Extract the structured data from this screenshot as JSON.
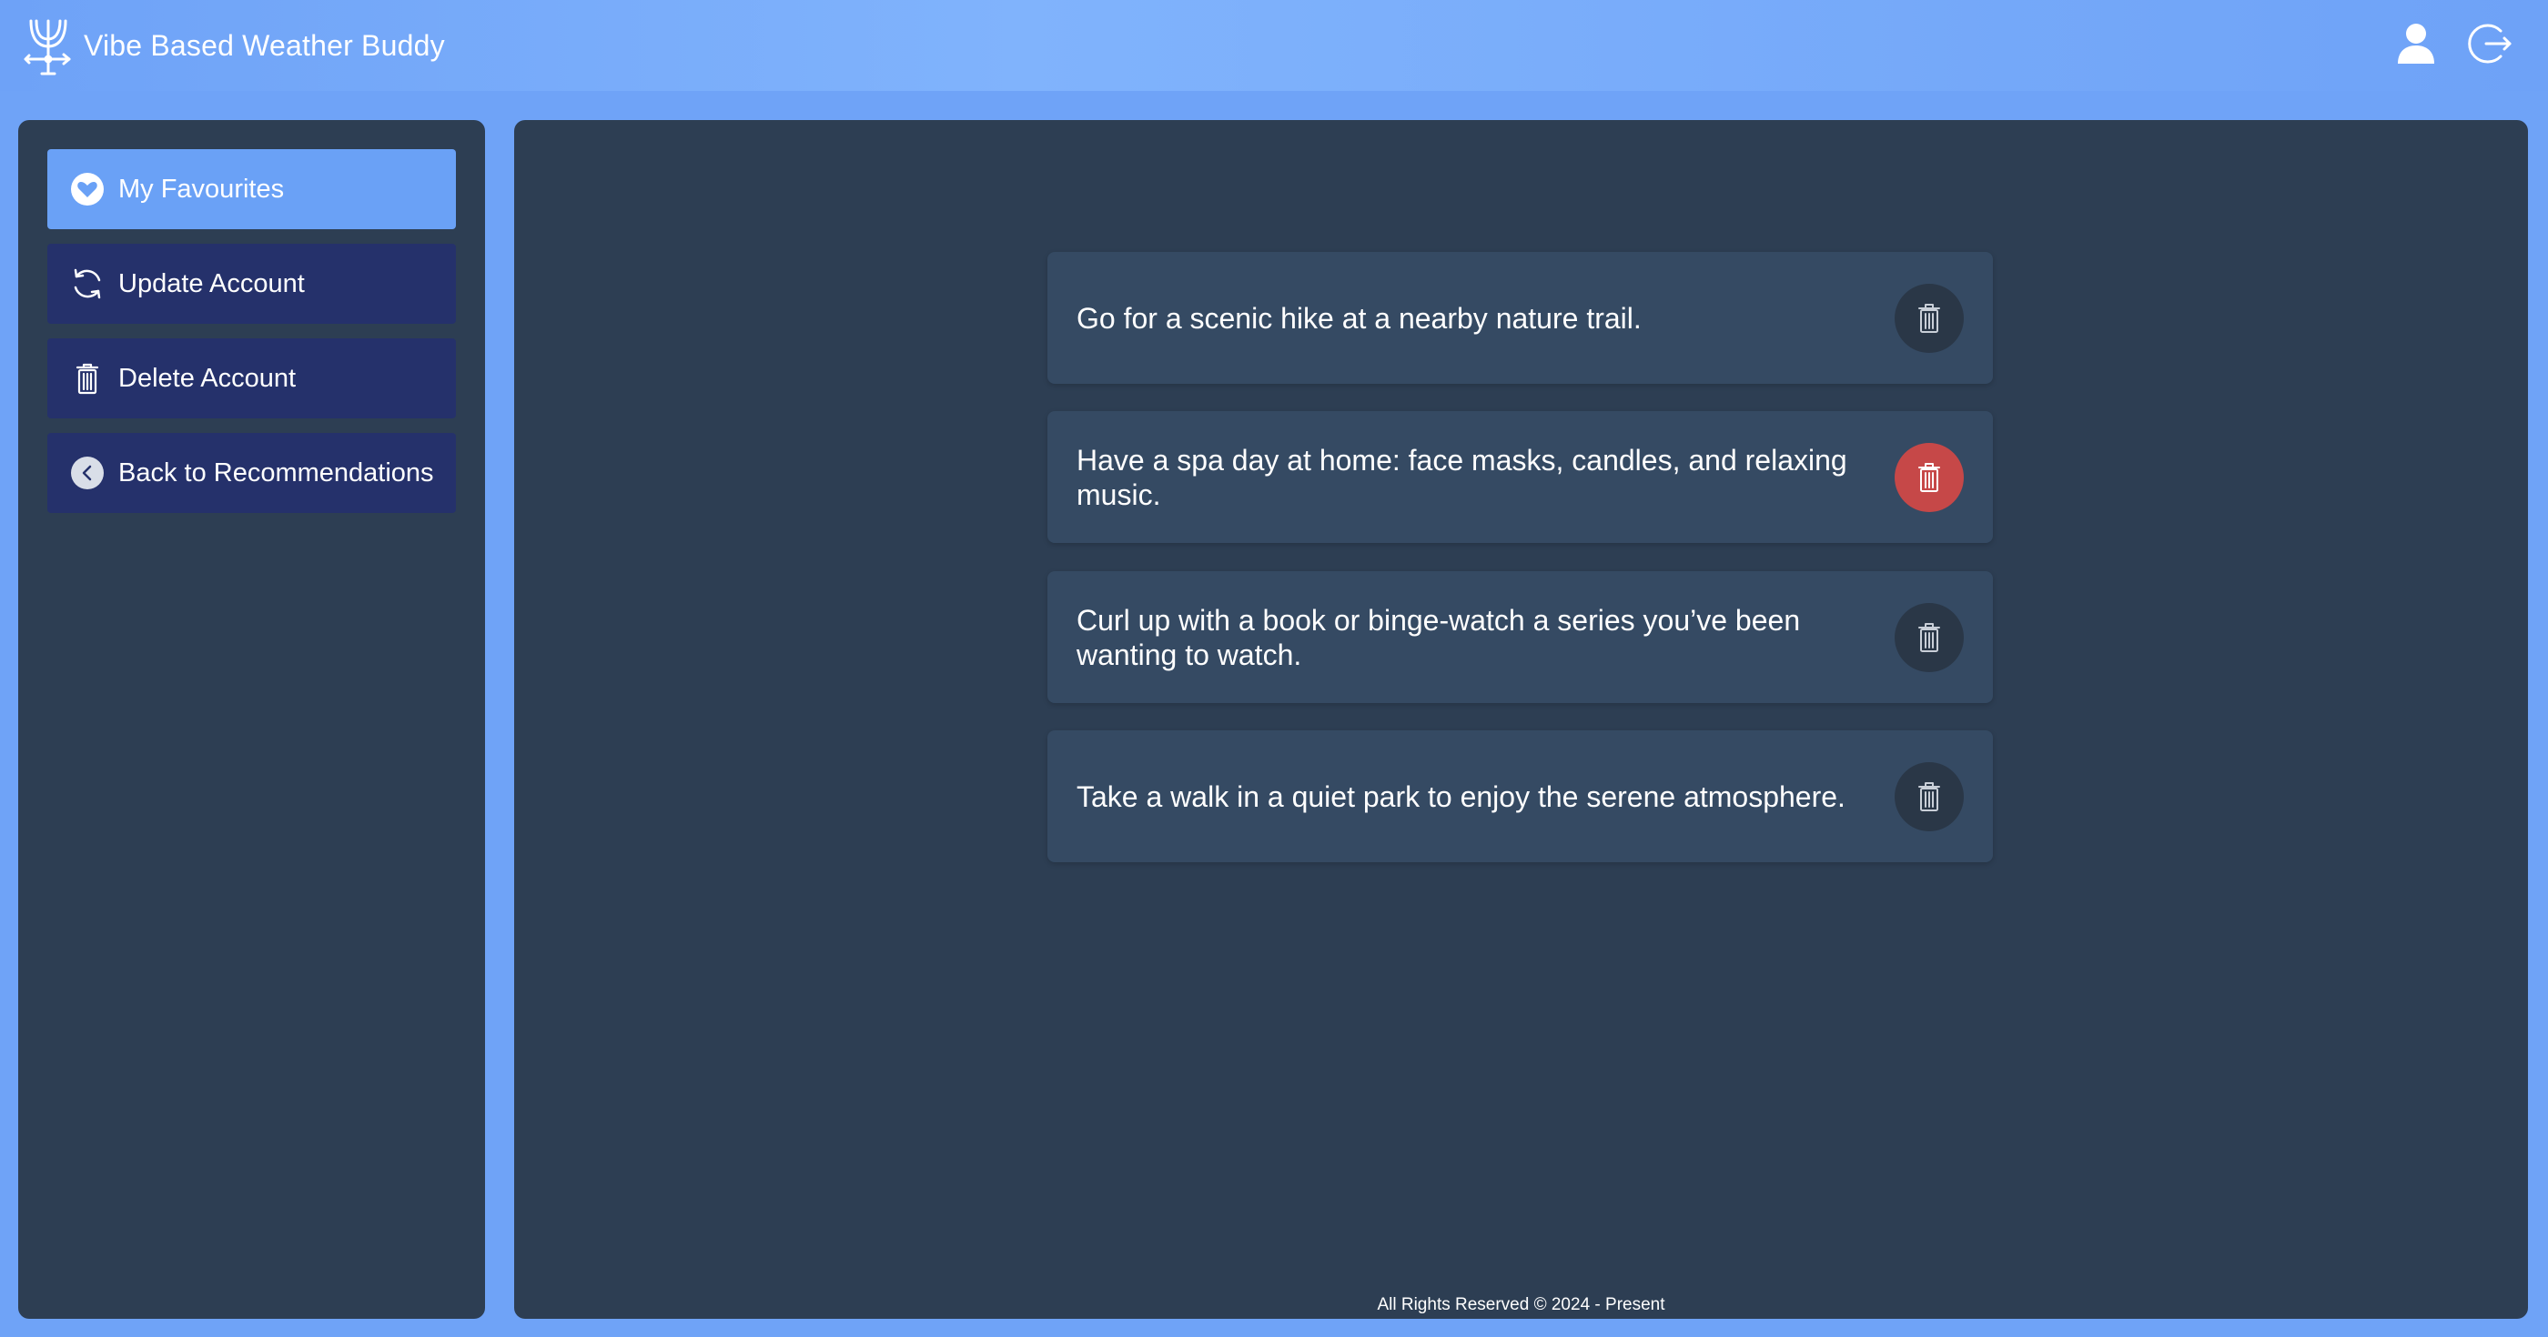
{
  "app": {
    "title": "Vibe Based Weather Buddy",
    "logo_icon": "weather-vane-icon",
    "header_icons": [
      "user-icon",
      "logout-icon"
    ]
  },
  "sidebar": {
    "items": [
      {
        "label": "My Favourites",
        "icon": "heart-icon",
        "active": true
      },
      {
        "label": "Update Account",
        "icon": "refresh-icon",
        "active": false
      },
      {
        "label": "Delete Account",
        "icon": "trash-icon",
        "active": false
      },
      {
        "label": "Back to Recommendations",
        "icon": "chevron-left-icon",
        "active": false
      }
    ]
  },
  "favourites": [
    {
      "text": "Go for a scenic hike at a nearby nature trail.",
      "action_icon": "trash-icon"
    },
    {
      "text": "Have a spa day at home: face masks, candles, and relaxing music.",
      "action_icon": "trash-icon",
      "highlighted": true
    },
    {
      "text": "Curl up with a book or binge-watch a series you’ve been wanting to watch.",
      "action_icon": "trash-icon"
    },
    {
      "text": "Take a walk in a quiet park to enjoy the serene atmosphere.",
      "action_icon": "trash-icon"
    }
  ],
  "footer": {
    "text": "All Rights Reserved © 2024 - Present"
  },
  "colors": {
    "background": "#6fa3f7",
    "panel": "#2d3e53",
    "card": "#354a63",
    "sidebar_button": "#25316b",
    "sidebar_active": "#6aa1f6",
    "delete_hover": "#c64848"
  }
}
